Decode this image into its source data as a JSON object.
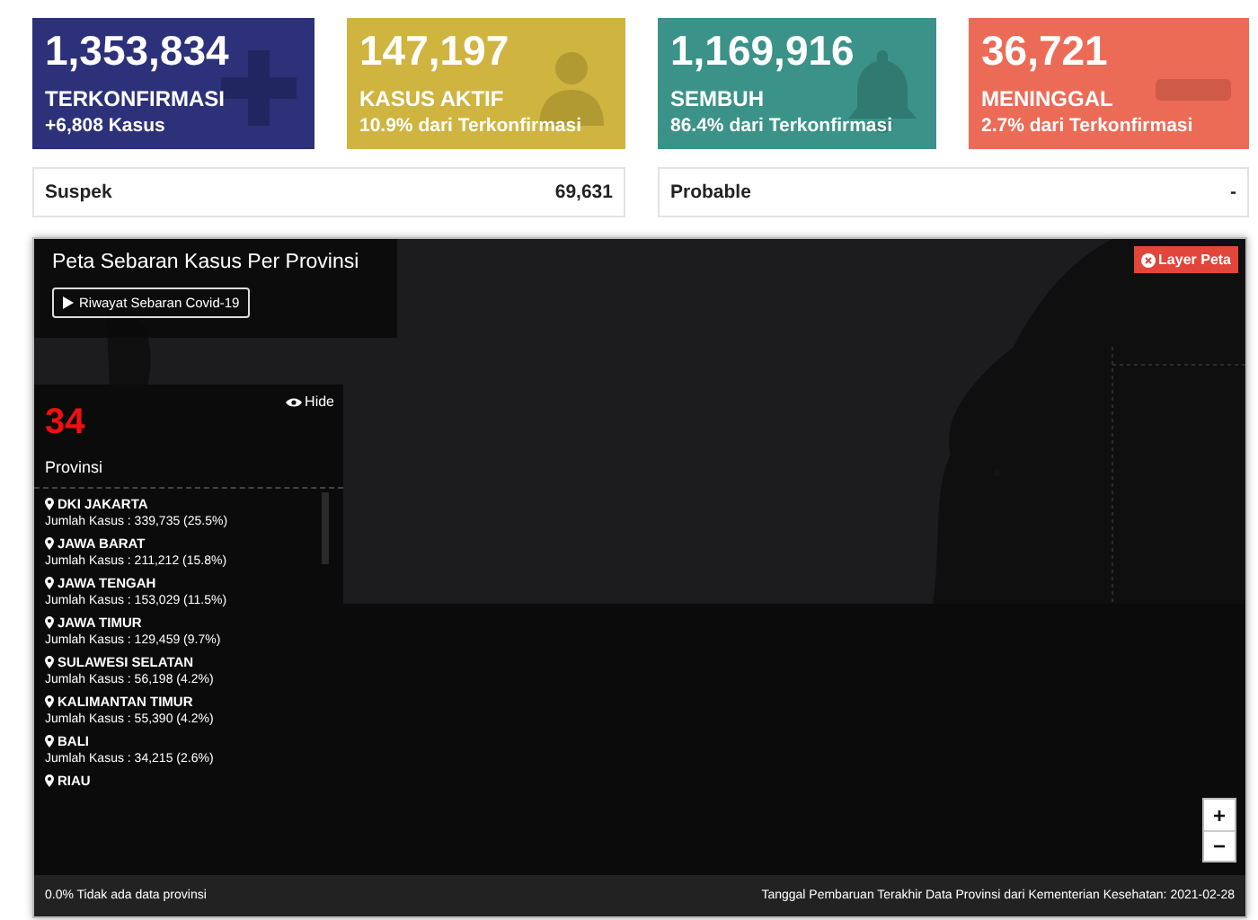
{
  "cards": [
    {
      "kind": "confirmed",
      "color": "#2c3179",
      "value": "1,353,834",
      "label": "TERKONFIRMASI",
      "sub": "+6,808 Kasus"
    },
    {
      "kind": "active",
      "color": "#cfb440",
      "value": "147,197",
      "label": "KASUS AKTIF",
      "sub": "10.9% dari Terkonfirmasi"
    },
    {
      "kind": "recovered",
      "color": "#3b9288",
      "value": "1,169,916",
      "label": "SEMBUH",
      "sub": "86.4% dari Terkonfirmasi"
    },
    {
      "kind": "deaths",
      "color": "#ec6b56",
      "value": "36,721",
      "label": "MENINGGAL",
      "sub": "2.7% dari Terkonfirmasi"
    }
  ],
  "summary": [
    {
      "label": "Suspek",
      "value": "69,631"
    },
    {
      "label": "Probable",
      "value": "-"
    }
  ],
  "map": {
    "title": "Peta Sebaran Kasus Per Provinsi",
    "history_button": "Riwayat Sebaran Covid-19",
    "layer_button": "Layer Peta",
    "panel": {
      "count": "34",
      "count_label": "Provinsi",
      "hide_label": "Hide",
      "items": [
        {
          "name": "DKI JAKARTA",
          "cases": "Jumlah Kasus : 339,735 (25.5%)"
        },
        {
          "name": "JAWA BARAT",
          "cases": "Jumlah Kasus : 211,212 (15.8%)"
        },
        {
          "name": "JAWA TENGAH",
          "cases": "Jumlah Kasus : 153,029 (11.5%)"
        },
        {
          "name": "JAWA TIMUR",
          "cases": "Jumlah Kasus : 129,459 (9.7%)"
        },
        {
          "name": "SULAWESI SELATAN",
          "cases": "Jumlah Kasus : 56,198 (4.2%)"
        },
        {
          "name": "KALIMANTAN TIMUR",
          "cases": "Jumlah Kasus : 55,390 (4.2%)"
        },
        {
          "name": "BALI",
          "cases": "Jumlah Kasus : 34,215 (2.6%)"
        },
        {
          "name": "RIAU"
        }
      ]
    },
    "zoom_in": "+",
    "zoom_out": "−",
    "footer_left": "0.0% Tidak ada data provinsi",
    "footer_right": "Tanggal Pembaruan Terakhir Data Provinsi dari Kementerian Kesehatan: 2021-02-28"
  }
}
